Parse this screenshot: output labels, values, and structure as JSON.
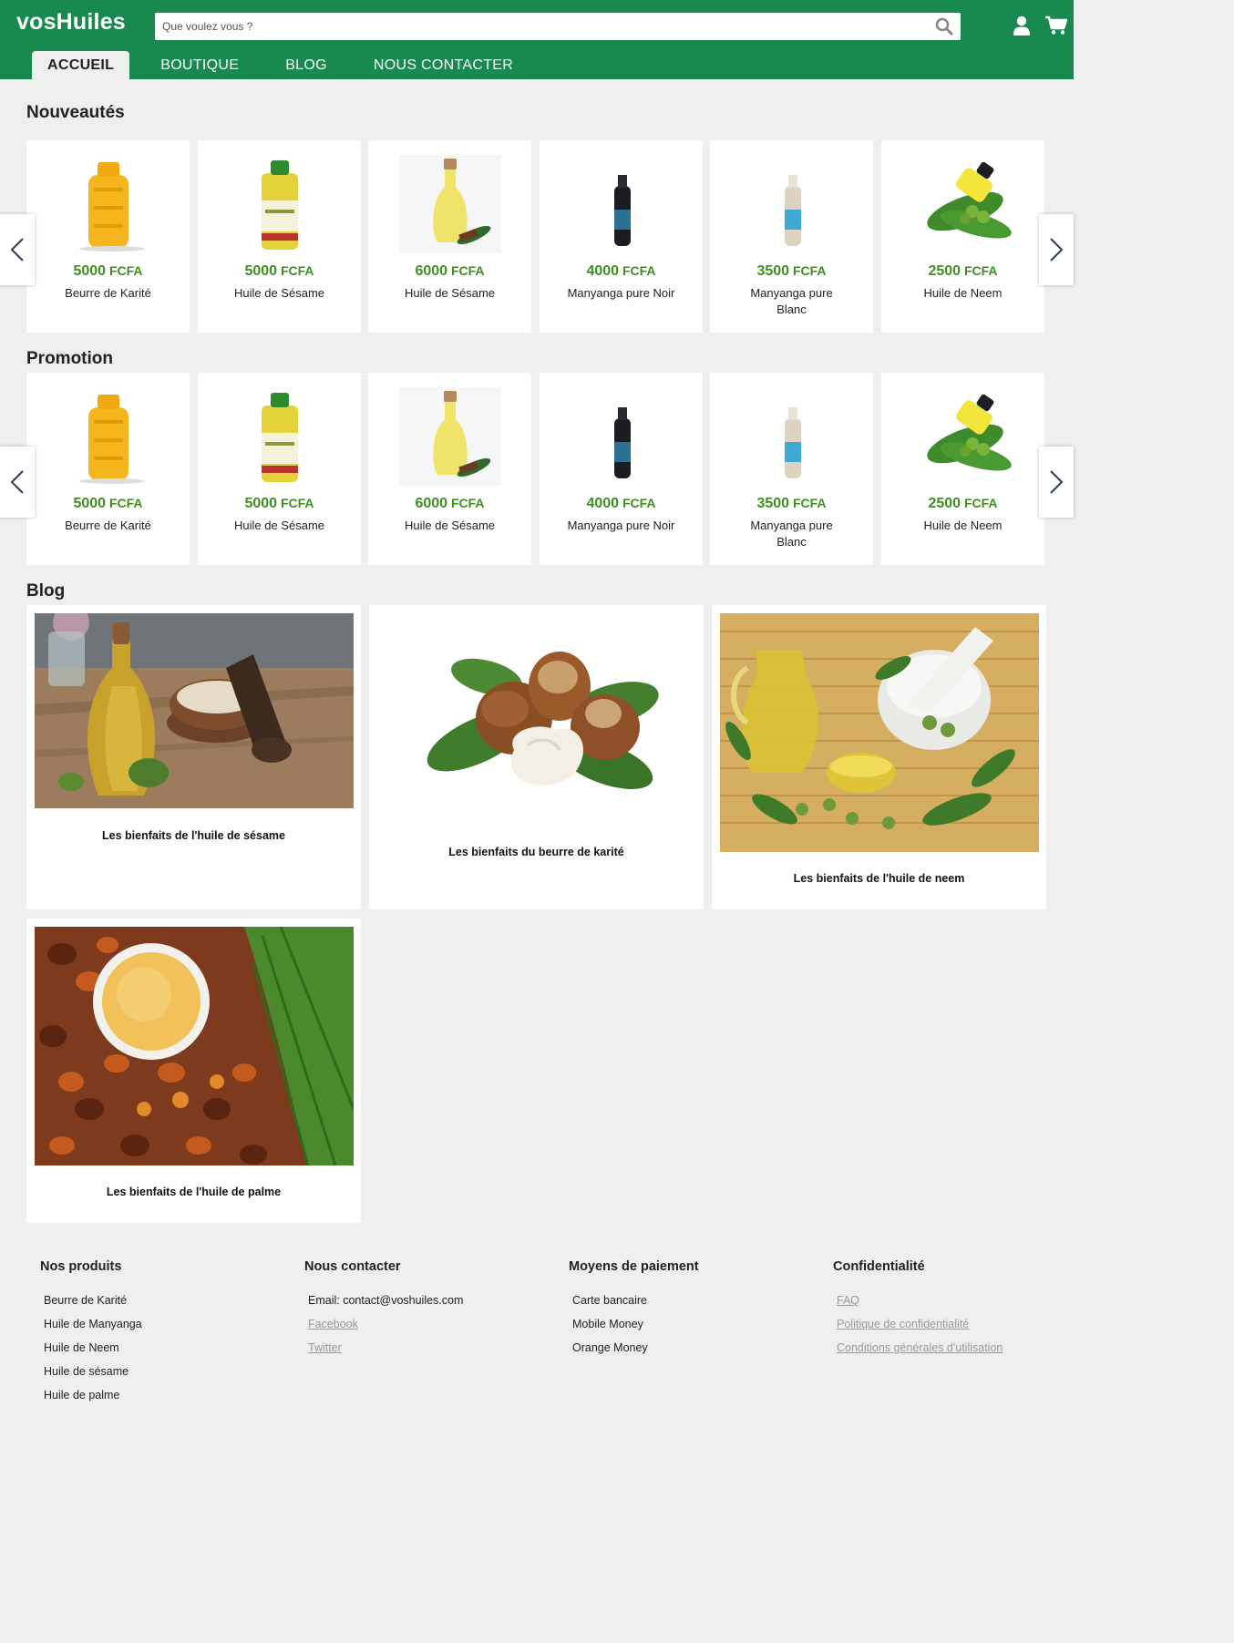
{
  "header": {
    "logo": "vosHuiles",
    "search_placeholder": "Que voulez vous ?",
    "nav": [
      {
        "label": "ACCUEIL",
        "active": true
      },
      {
        "label": "BOUTIQUE",
        "active": false
      },
      {
        "label": "BLOG",
        "active": false
      },
      {
        "label": "NOUS CONTACTER",
        "active": false
      }
    ]
  },
  "sections": {
    "new": "Nouveautés",
    "promo": "Promotion",
    "blog": "Blog"
  },
  "products": [
    {
      "amount": "5000",
      "currency": "FCFA",
      "name": "Beurre de Karité",
      "image": "yellow-jug"
    },
    {
      "amount": "5000",
      "currency": "FCFA",
      "name": "Huile de Sésame",
      "image": "sesame-bottle"
    },
    {
      "amount": "6000",
      "currency": "FCFA",
      "name": "Huile de Sésame",
      "image": "small-oil-bottle"
    },
    {
      "amount": "4000",
      "currency": "FCFA",
      "name": "Manyanga pure Noir",
      "image": "dark-bottle"
    },
    {
      "amount": "3500",
      "currency": "FCFA",
      "name": "Manyanga pure Blanc",
      "image": "white-bottle"
    },
    {
      "amount": "2500",
      "currency": "FCFA",
      "name": "Huile de Neem",
      "image": "neem-vial"
    }
  ],
  "promotions": [
    {
      "amount": "5000",
      "currency": "FCFA",
      "name": "Beurre de Karité",
      "image": "yellow-jug"
    },
    {
      "amount": "5000",
      "currency": "FCFA",
      "name": "Huile de Sésame",
      "image": "sesame-bottle"
    },
    {
      "amount": "6000",
      "currency": "FCFA",
      "name": "Huile de Sésame",
      "image": "small-oil-bottle"
    },
    {
      "amount": "4000",
      "currency": "FCFA",
      "name": "Manyanga pure Noir",
      "image": "dark-bottle"
    },
    {
      "amount": "3500",
      "currency": "FCFA",
      "name": "Manyanga pure Blanc",
      "image": "white-bottle"
    },
    {
      "amount": "2500",
      "currency": "FCFA",
      "name": "Huile de Neem",
      "image": "neem-vial"
    }
  ],
  "blog": [
    {
      "title": "Les bienfaits de l'huile de sésame",
      "image": "sesame-oil-photo"
    },
    {
      "title": "Les bienfaits du beurre de karité",
      "image": "shea-nuts-photo"
    },
    {
      "title": "Les bienfaits de l'huile de neem",
      "image": "neem-mortar-photo"
    },
    {
      "title": "Les bienfaits de l'huile de palme",
      "image": "palm-fruits-photo"
    }
  ],
  "footer": {
    "products": {
      "title": "Nos produits",
      "items": [
        "Beurre de Karité",
        "Huile de Manyanga",
        "Huile de Neem",
        "Huile de sésame",
        "Huile de palme"
      ]
    },
    "contact": {
      "title": "Nous contacter",
      "email": "Email: contact@voshuiles.com",
      "links": [
        "Facebook",
        "Twitter"
      ]
    },
    "payment": {
      "title": "Moyens de paiement",
      "items": [
        "Carte bancaire",
        "Mobile Money",
        "Orange Money"
      ]
    },
    "privacy": {
      "title": "Confidentialité",
      "links": [
        "FAQ",
        "Politique de confidentialité",
        "Conditions générales d'utilisation"
      ]
    }
  },
  "colors": {
    "brand_green": "#188a50",
    "price_green": "#3f8f1f",
    "page_bg": "#efefef"
  },
  "icons": [
    "search-icon",
    "user-icon",
    "cart-icon",
    "chevron-left-icon",
    "chevron-right-icon"
  ]
}
